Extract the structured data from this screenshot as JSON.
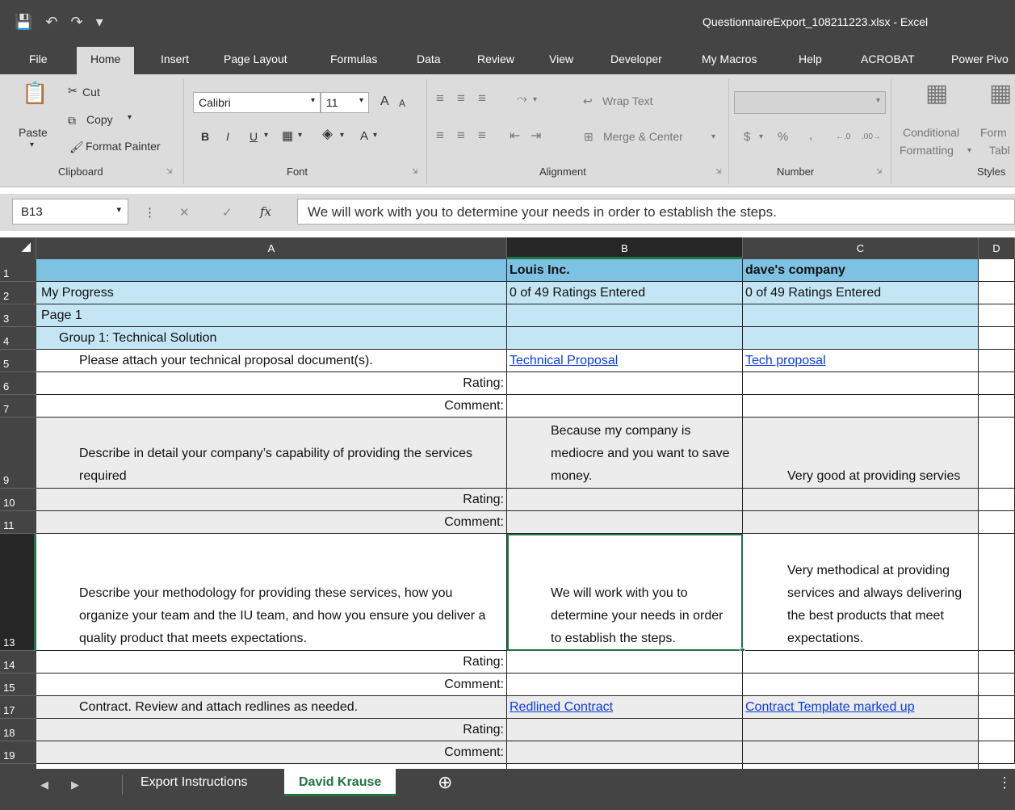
{
  "window": {
    "title": "QuestionnaireExport_108211223.xlsx  -  Excel"
  },
  "menu": {
    "tabs": [
      "File",
      "Home",
      "Insert",
      "Page Layout",
      "Formulas",
      "Data",
      "Review",
      "View",
      "Developer",
      "My Macros",
      "Help",
      "ACROBAT",
      "Power Pivo"
    ]
  },
  "ribbon": {
    "clipboard": {
      "paste": "Paste",
      "cut": "Cut",
      "copy": "Copy",
      "format_painter": "Format Painter",
      "group": "Clipboard"
    },
    "font": {
      "name": "Calibri",
      "size": "11",
      "bold": "B",
      "italic": "I",
      "underline": "U",
      "grow": "A",
      "shrink": "A",
      "color": "A",
      "group": "Font"
    },
    "alignment": {
      "wrap_text": "Wrap Text",
      "merge_center": "Merge & Center",
      "group": "Alignment"
    },
    "number": {
      "format": "",
      "currency": "$",
      "percent": "%",
      "comma": ",",
      "group": "Number"
    },
    "styles": {
      "conditional": "Conditional",
      "formatting": "Formatting",
      "form": "Form",
      "table": "Tabl",
      "group": "Styles"
    }
  },
  "formula_bar": {
    "name_box": "B13",
    "fx": "fx",
    "formula": "We will work with you to determine your needs in order to establish the steps."
  },
  "grid": {
    "columns": [
      "A",
      "B",
      "C",
      "D"
    ],
    "rows": [
      {
        "num": "1",
        "a": "",
        "b": "Louis Inc.",
        "c": "dave's company"
      },
      {
        "num": "2",
        "a": "My Progress",
        "b": "0 of 49 Ratings Entered",
        "c": "0 of 49 Ratings Entered"
      },
      {
        "num": "3",
        "a": "Page 1",
        "b": "",
        "c": ""
      },
      {
        "num": "4",
        "a": "Group 1: Technical Solution",
        "b": "",
        "c": ""
      },
      {
        "num": "5",
        "a": "Please attach your technical proposal document(s).",
        "b": "Technical Proposal",
        "c": "Tech proposal"
      },
      {
        "num": "6",
        "a": "Rating:",
        "b": "",
        "c": ""
      },
      {
        "num": "7",
        "a": "Comment:",
        "b": "",
        "c": ""
      },
      {
        "num": "9",
        "a": "Describe in detail your company’s capability of providing the services required",
        "b": "Because my company is mediocre and you want to save money.",
        "c": "Very good at providing servies"
      },
      {
        "num": "10",
        "a": "Rating:",
        "b": "",
        "c": ""
      },
      {
        "num": "11",
        "a": "Comment:",
        "b": "",
        "c": ""
      },
      {
        "num": "13",
        "a": "Describe your methodology for providing these services, how you organize your team and the IU team, and how you ensure you deliver a quality product that meets expectations.",
        "b": "We will work with you to determine your needs in order to establish the steps.",
        "c": "Very methodical at providing services and always delivering the best products that meet expectations."
      },
      {
        "num": "14",
        "a": "Rating:",
        "b": "",
        "c": ""
      },
      {
        "num": "15",
        "a": "Comment:",
        "b": "",
        "c": ""
      },
      {
        "num": "17",
        "a": "Contract.  Review and attach redlines as needed.",
        "b": "Redlined Contract",
        "c": "Contract Template marked up"
      },
      {
        "num": "18",
        "a": "Rating:",
        "b": "",
        "c": ""
      },
      {
        "num": "19",
        "a": "Comment:",
        "b": "",
        "c": ""
      }
    ]
  },
  "sheets": {
    "tabs": [
      "Export Instructions",
      "David Krause"
    ],
    "active": "David Krause"
  },
  "colors": {
    "header_blue": "#7dc2e3",
    "light_blue": "#c4e6f4",
    "excel_green": "#217346",
    "link": "#0b3ce0"
  }
}
